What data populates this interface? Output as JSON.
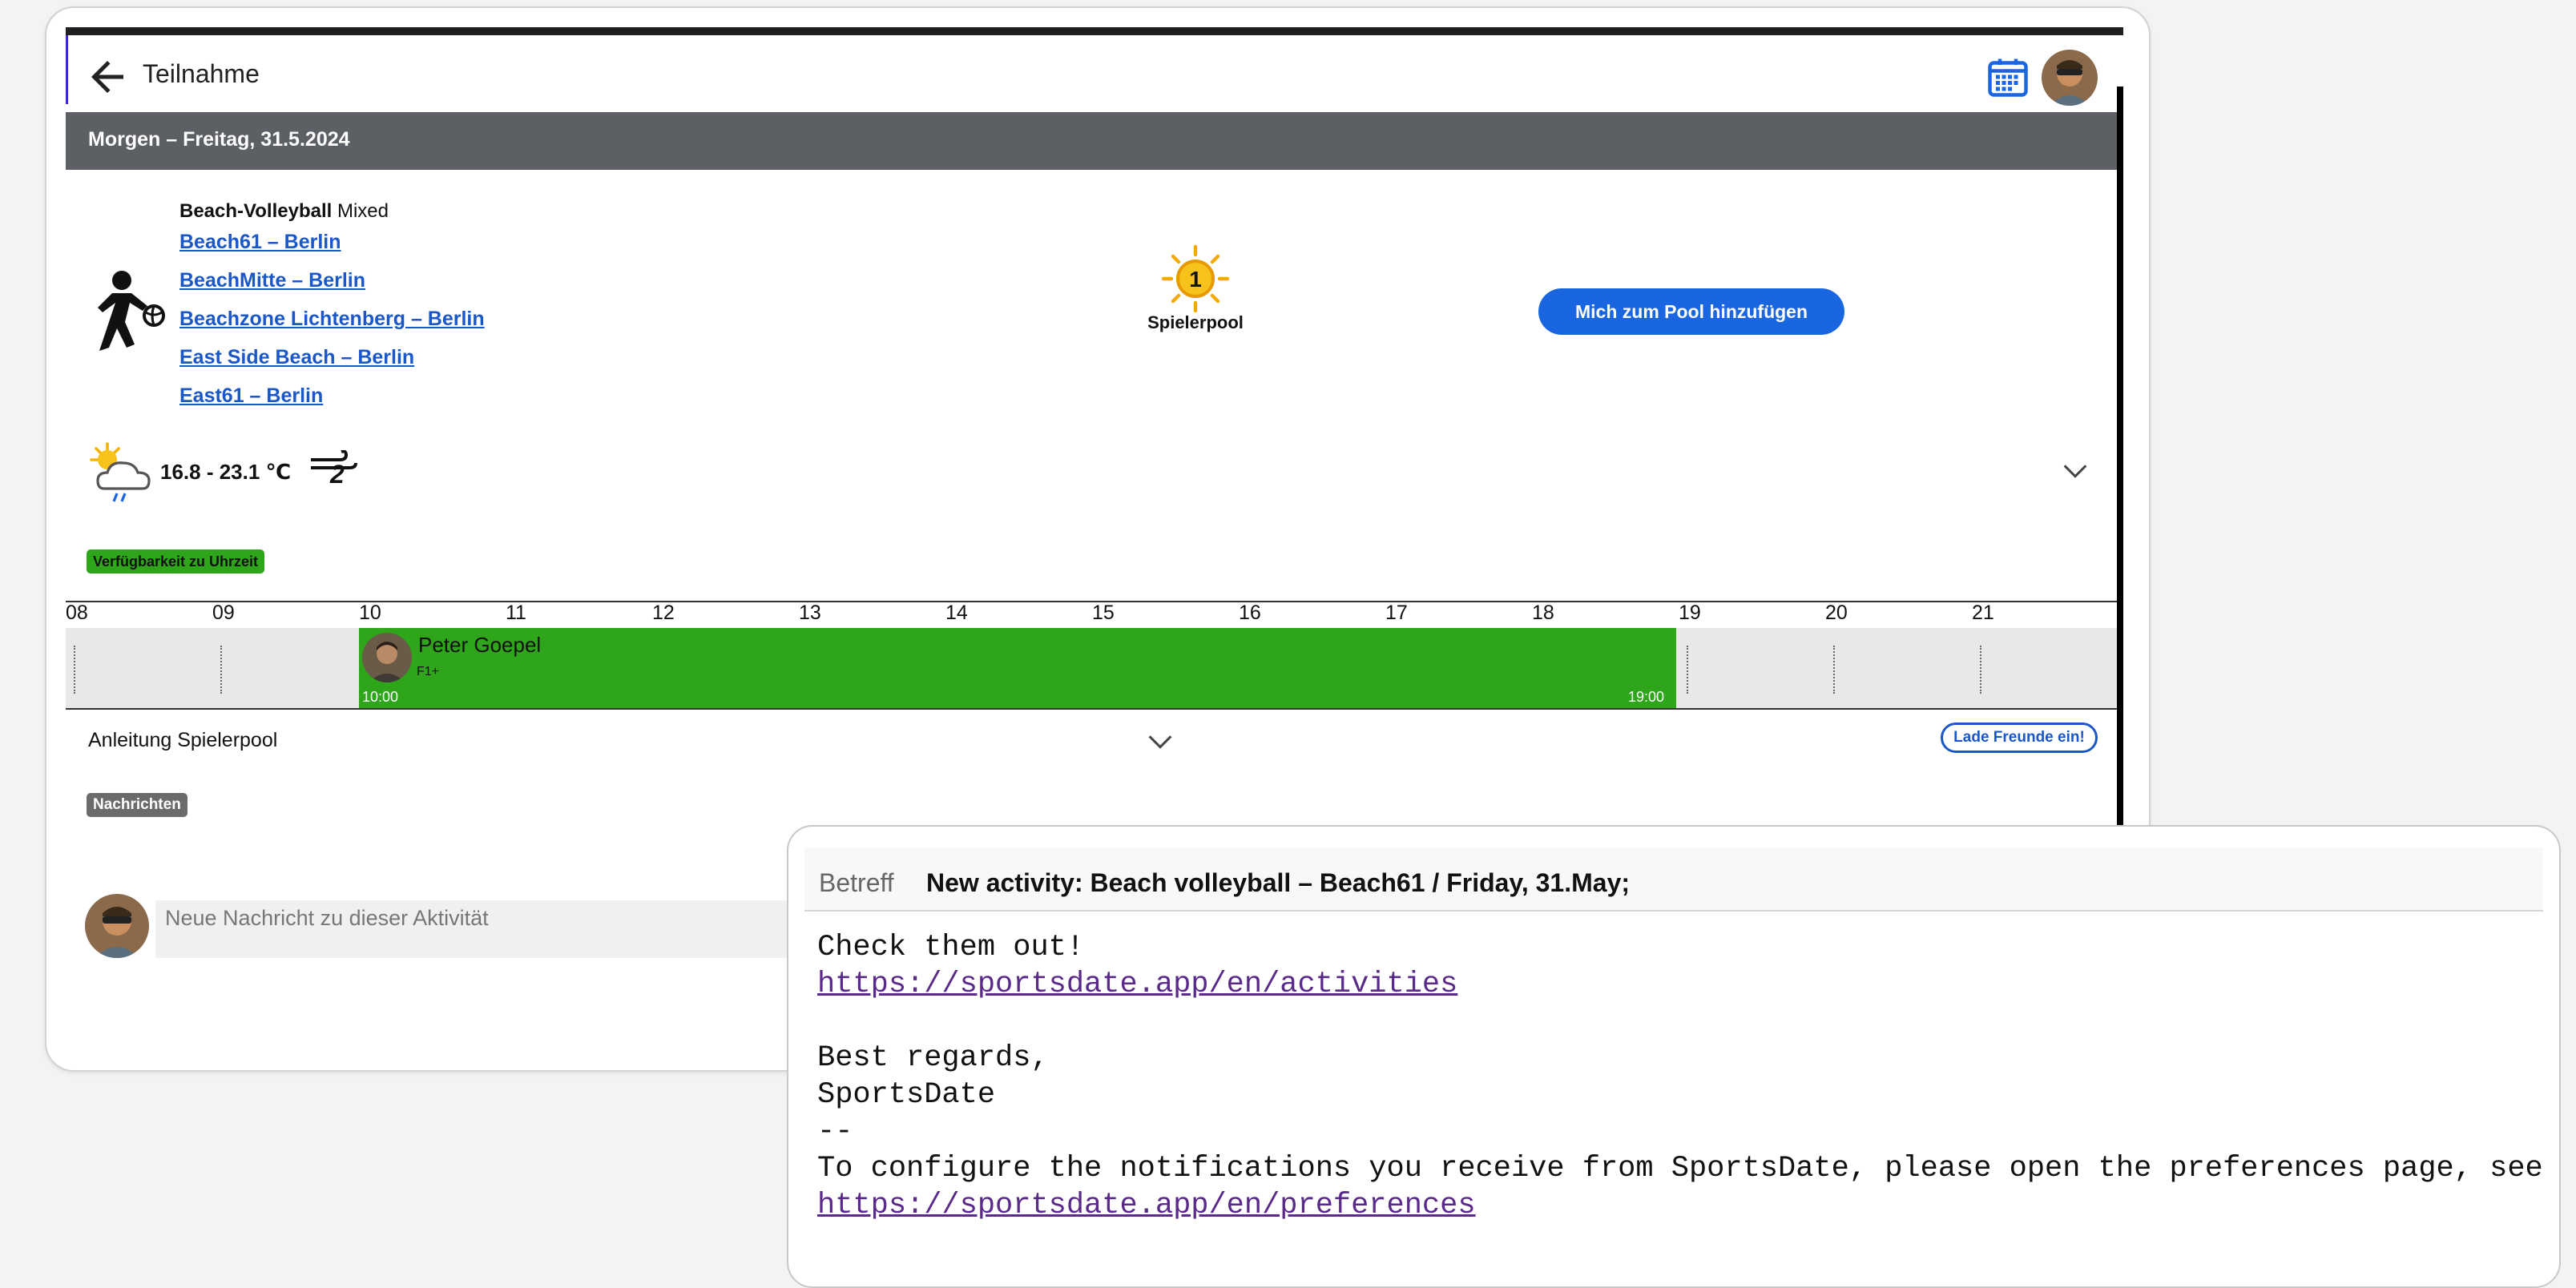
{
  "header": {
    "title": "Teilnahme",
    "icons": [
      "back-arrow-icon",
      "calendar-icon",
      "user-avatar"
    ]
  },
  "date_header": "Morgen – Freitag, 31.5.2024",
  "activity": {
    "sport": "Beach-Volleyball",
    "category": "Mixed",
    "locations": [
      "Beach61 – Berlin",
      "BeachMitte – Berlin",
      "Beachzone Lichtenberg – Berlin",
      "East Side Beach – Berlin",
      "East61 – Berlin"
    ],
    "pool_count": "1",
    "pool_label": "Spielerpool",
    "pool_button": "Mich zum Pool hinzufügen"
  },
  "weather": {
    "temperature": "16.8 - 23.1 ℃",
    "wind": "2",
    "icon": "partly-cloudy-rain-icon"
  },
  "availability": {
    "badge": "Verfügbarkeit zu Uhrzeit",
    "hours": [
      "08",
      "09",
      "10",
      "11",
      "12",
      "13",
      "14",
      "15",
      "16",
      "17",
      "18",
      "19",
      "20",
      "21"
    ],
    "player": {
      "name": "Peter Goepel",
      "level": "F1+",
      "start": "10:00",
      "end": "19:00"
    },
    "color": "#2ea51a"
  },
  "guide": {
    "label": "Anleitung Spielerpool",
    "invite_button": "Lade Freunde ein!"
  },
  "messages": {
    "badge": "Nachrichten",
    "input_placeholder": "Neue Nachricht zu dieser Aktivität"
  },
  "email": {
    "subject_label": "Betreff",
    "subject": "New activity: Beach volleyball – Beach61 / Friday, 31.May;",
    "line1": "Check them out!",
    "link1": "https://sportsdate.app/en/activities",
    "line2": "Best regards,",
    "line3": "SportsDate",
    "line4": "--",
    "line5": "To configure the notifications you receive from SportsDate, please open the preferences page, see",
    "link2": "https://sportsdate.app/en/preferences"
  },
  "colors": {
    "header_gray": "#5c5f63",
    "primary_blue": "#1a66e0",
    "link_blue": "#1a57c8",
    "green": "#2ea51a"
  }
}
